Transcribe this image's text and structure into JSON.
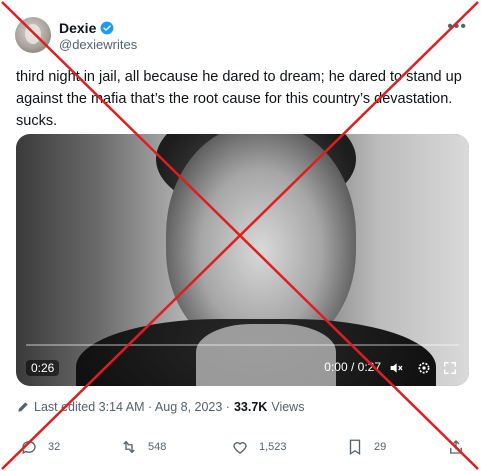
{
  "author": {
    "name": "Dexie",
    "handle": "@dexiewrites"
  },
  "tweet": {
    "text": "third night in jail, all because he dared to dream; he dared to stand up\nagainst the mafia that’s the root cause for this country’s devastation.\nsucks."
  },
  "video": {
    "duration_badge": "0:26",
    "timecode": "0:00 / 0:27",
    "progress": 0
  },
  "meta": {
    "edited_label": "Last edited 3:14 AM · Aug 8, 2023 ·",
    "views_count": "33.7K",
    "views_label": "Views"
  },
  "actions": {
    "replies": "32",
    "retweets": "548",
    "likes": "1,523",
    "bookmarks": "29"
  },
  "colors": {
    "verified": "#1d9bf0",
    "overlay_x": "#e11d1d"
  },
  "icons": [
    "verified-badge-icon",
    "more-icon",
    "pencil-icon",
    "reply-icon",
    "retweet-icon",
    "like-icon",
    "bookmark-icon",
    "share-icon",
    "mute-icon",
    "settings-icon",
    "fullscreen-icon"
  ]
}
